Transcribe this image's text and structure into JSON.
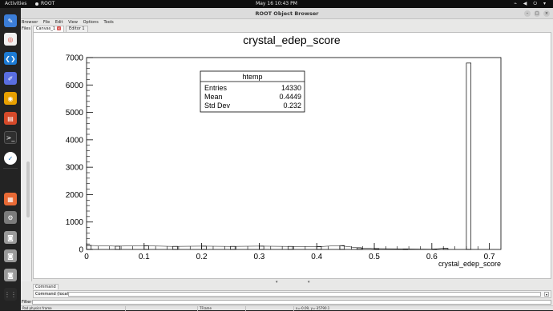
{
  "topbar": {
    "activities": "Activities",
    "app_name": "ROOT",
    "clock": "May 16  10:43 PM",
    "tray_icons": [
      "network-icon",
      "volume-icon",
      "power-icon",
      "chevron-down-icon"
    ]
  },
  "dock": {
    "items": [
      "notes-icon",
      "chrome-icon",
      "vscode-icon",
      "text-editor-icon",
      "chrome-alt-icon",
      "document-viewer-icon",
      "terminal-icon",
      "root-app-icon",
      "software-icon",
      "settings-icon",
      "drive-icon",
      "drive-icon",
      "drive-icon",
      "drive-icon"
    ]
  },
  "window": {
    "title": "ROOT Object Browser",
    "menu": [
      "Browser",
      "File",
      "Edit",
      "View",
      "Options",
      "Tools"
    ],
    "files_label": "Files",
    "tabs": [
      {
        "label": "Canvas_1"
      },
      {
        "label": "Editor 1"
      }
    ]
  },
  "histogram": {
    "title": "crystal_edep_score",
    "stats": {
      "name": "htemp",
      "rows": [
        {
          "label": "Entries",
          "value": "14330"
        },
        {
          "label": "Mean",
          "value": "0.4449"
        },
        {
          "label": "Std Dev",
          "value": "0.232"
        }
      ]
    }
  },
  "chart_data": {
    "type": "bar",
    "title": "crystal_edep_score",
    "xlabel": "crystal_edep_score",
    "ylabel": "",
    "xlim": [
      0,
      0.72
    ],
    "ylim": [
      0,
      7000
    ],
    "x_ticks": [
      "0",
      "0.1",
      "0.2",
      "0.3",
      "0.4",
      "0.5",
      "0.6",
      "0.7"
    ],
    "y_ticks": [
      "0",
      "1000",
      "2000",
      "3000",
      "4000",
      "5000",
      "6000",
      "7000"
    ],
    "bins": [
      {
        "x": 0.0,
        "value": 150
      },
      {
        "x": 0.05,
        "value": 120
      },
      {
        "x": 0.1,
        "value": 130
      },
      {
        "x": 0.15,
        "value": 110
      },
      {
        "x": 0.2,
        "value": 120
      },
      {
        "x": 0.25,
        "value": 110
      },
      {
        "x": 0.3,
        "value": 120
      },
      {
        "x": 0.35,
        "value": 110
      },
      {
        "x": 0.4,
        "value": 100
      },
      {
        "x": 0.44,
        "value": 140
      },
      {
        "x": 0.47,
        "value": 60
      },
      {
        "x": 0.5,
        "value": 30
      },
      {
        "x": 0.55,
        "value": 20
      },
      {
        "x": 0.6,
        "value": 10
      },
      {
        "x": 0.62,
        "value": 40
      },
      {
        "x": 0.66,
        "value": 6800
      }
    ]
  },
  "command": {
    "tab_label": "Command",
    "field_label": "Command (local):",
    "value": ""
  },
  "filter": {
    "label": "Filter",
    "value": ""
  },
  "statusbar": {
    "cells": [
      "Pad physics frame",
      "",
      "TFrame",
      "",
      "x=-0.09, y=-35790.1"
    ]
  }
}
